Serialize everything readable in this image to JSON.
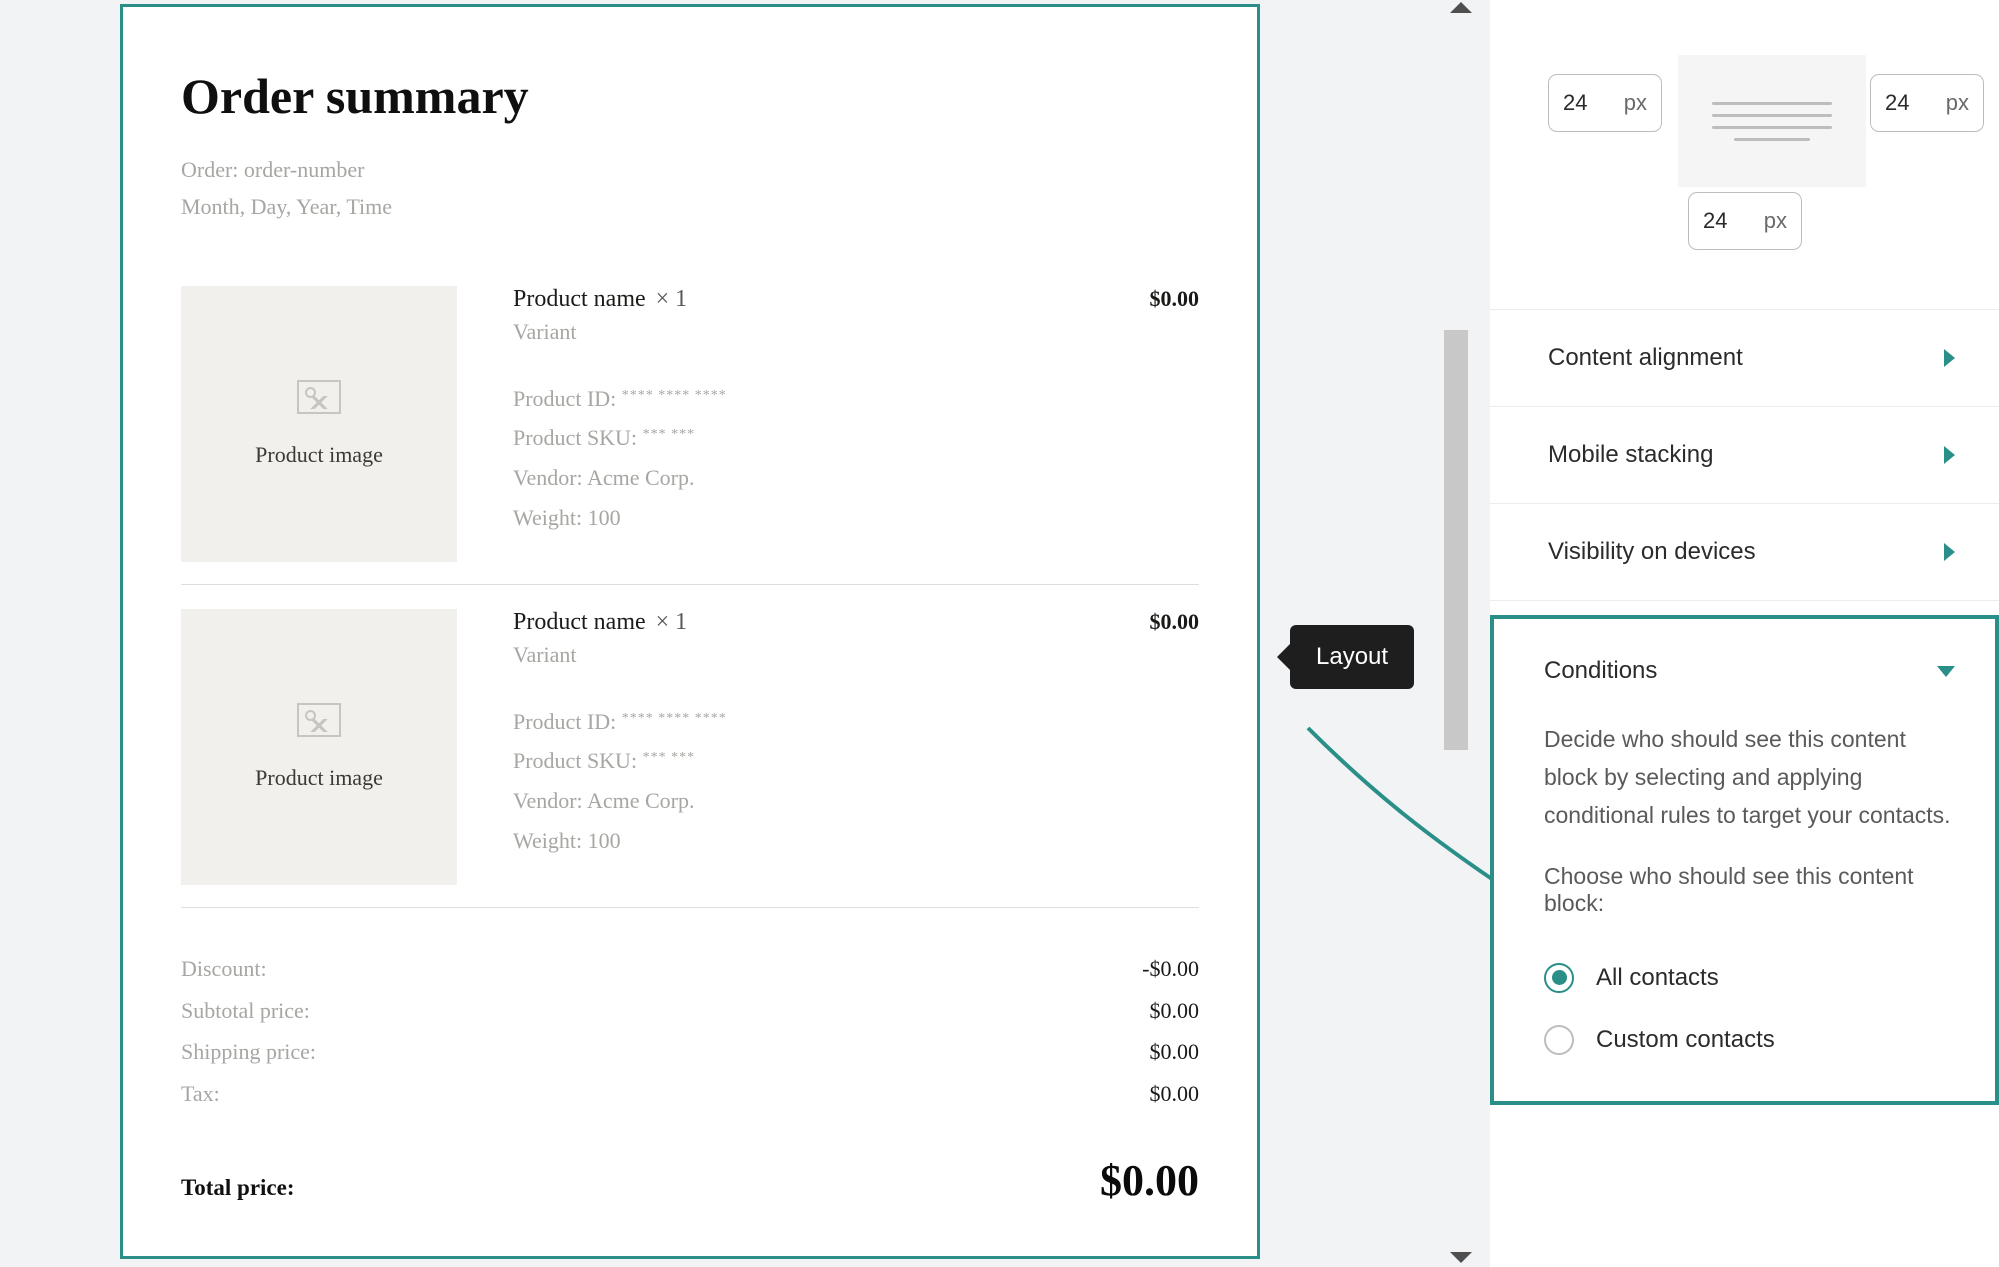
{
  "order": {
    "title": "Order summary",
    "orderLine": "Order: order-number",
    "dateLine": "Month, Day, Year, Time",
    "imageCaption": "Product image",
    "products": [
      {
        "name": "Product name",
        "qty": "× 1",
        "variant": "Variant",
        "idLabel": "Product ID:",
        "idMask": "**** **** ****",
        "skuLabel": "Product SKU:",
        "skuMask": "*** ***",
        "vendorLabel": "Vendor:",
        "vendor": "Acme Corp.",
        "weightLabel": "Weight:",
        "weight": "100",
        "price": "$0.00"
      },
      {
        "name": "Product name",
        "qty": "× 1",
        "variant": "Variant",
        "idLabel": "Product ID:",
        "idMask": "**** **** ****",
        "skuLabel": "Product SKU:",
        "skuMask": "*** ***",
        "vendorLabel": "Vendor:",
        "vendor": "Acme Corp.",
        "weightLabel": "Weight:",
        "weight": "100",
        "price": "$0.00"
      }
    ],
    "totals": {
      "discountLabel": "Discount:",
      "discount": "$0.00",
      "subtotalLabel": "Subtotal price:",
      "subtotal": "$0.00",
      "shippingLabel": "Shipping price:",
      "shipping": "$0.00",
      "taxLabel": "Tax:",
      "tax": "$0.00",
      "totalLabel": "Total price:",
      "total": "$0.00"
    }
  },
  "tooltip": {
    "layout": "Layout"
  },
  "sidebar": {
    "spacing": {
      "left": "24",
      "right": "24",
      "bottom": "24",
      "unit": "px"
    },
    "rows": {
      "contentAlignment": "Content alignment",
      "mobileStacking": "Mobile stacking",
      "visibility": "Visibility on devices"
    },
    "conditions": {
      "title": "Conditions",
      "desc": "Decide who should see this content block by selecting and applying conditional rules to target your contacts.",
      "subhead": "Choose who should see this content block:",
      "optionAll": "All contacts",
      "optionCustom": "Custom contacts",
      "selected": "all"
    }
  },
  "colors": {
    "accent": "#2a8f88"
  }
}
